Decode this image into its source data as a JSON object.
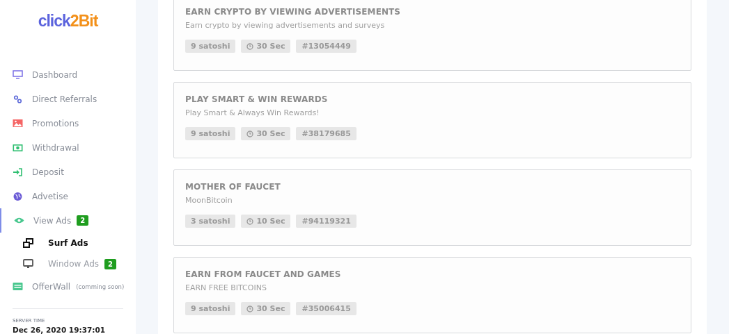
{
  "logo": {
    "first": "click",
    "second": "2Bit"
  },
  "sidebar": {
    "items": [
      {
        "label": "Dashboard",
        "selected": false
      },
      {
        "label": "Direct Referrals",
        "selected": false
      },
      {
        "label": "Promotions",
        "selected": false
      },
      {
        "label": "Withdrawal",
        "selected": false
      },
      {
        "label": "Deposit",
        "selected": false
      },
      {
        "label": "Advetise",
        "selected": false
      },
      {
        "label": "View Ads",
        "selected": true,
        "badge": "2",
        "children": [
          {
            "label": "Surf Ads",
            "selected": true
          },
          {
            "label": "Window Ads",
            "selected": false,
            "badge": "2"
          }
        ]
      },
      {
        "label": "OfferWall",
        "selected": false,
        "note": "(comming soon)"
      }
    ]
  },
  "server_time": {
    "label": "SERVER TIME",
    "value": "Dec 26, 2020 19:37:01"
  },
  "ads": [
    {
      "title": "EARN CRYPTO BY VIEWING ADVERTISEMENTS",
      "description": "Earn crypto by viewing advertisements and surveys",
      "reward": "9 satoshi",
      "duration": "30 Sec",
      "id": "#13054449"
    },
    {
      "title": "PLAY SMART & WIN REWARDS",
      "description": "Play Smart & Always Win Rewards!",
      "reward": "9 satoshi",
      "duration": "30 Sec",
      "id": "#38179685"
    },
    {
      "title": "MOTHER OF FAUCET",
      "description": "MoonBitcoin",
      "reward": "3 satoshi",
      "duration": "10 Sec",
      "id": "#94119321"
    },
    {
      "title": "EARN FROM FAUCET AND GAMES",
      "description": "EARN FREE BITCOINS",
      "reward": "9 satoshi",
      "duration": "30 Sec",
      "id": "#35006415"
    }
  ]
}
